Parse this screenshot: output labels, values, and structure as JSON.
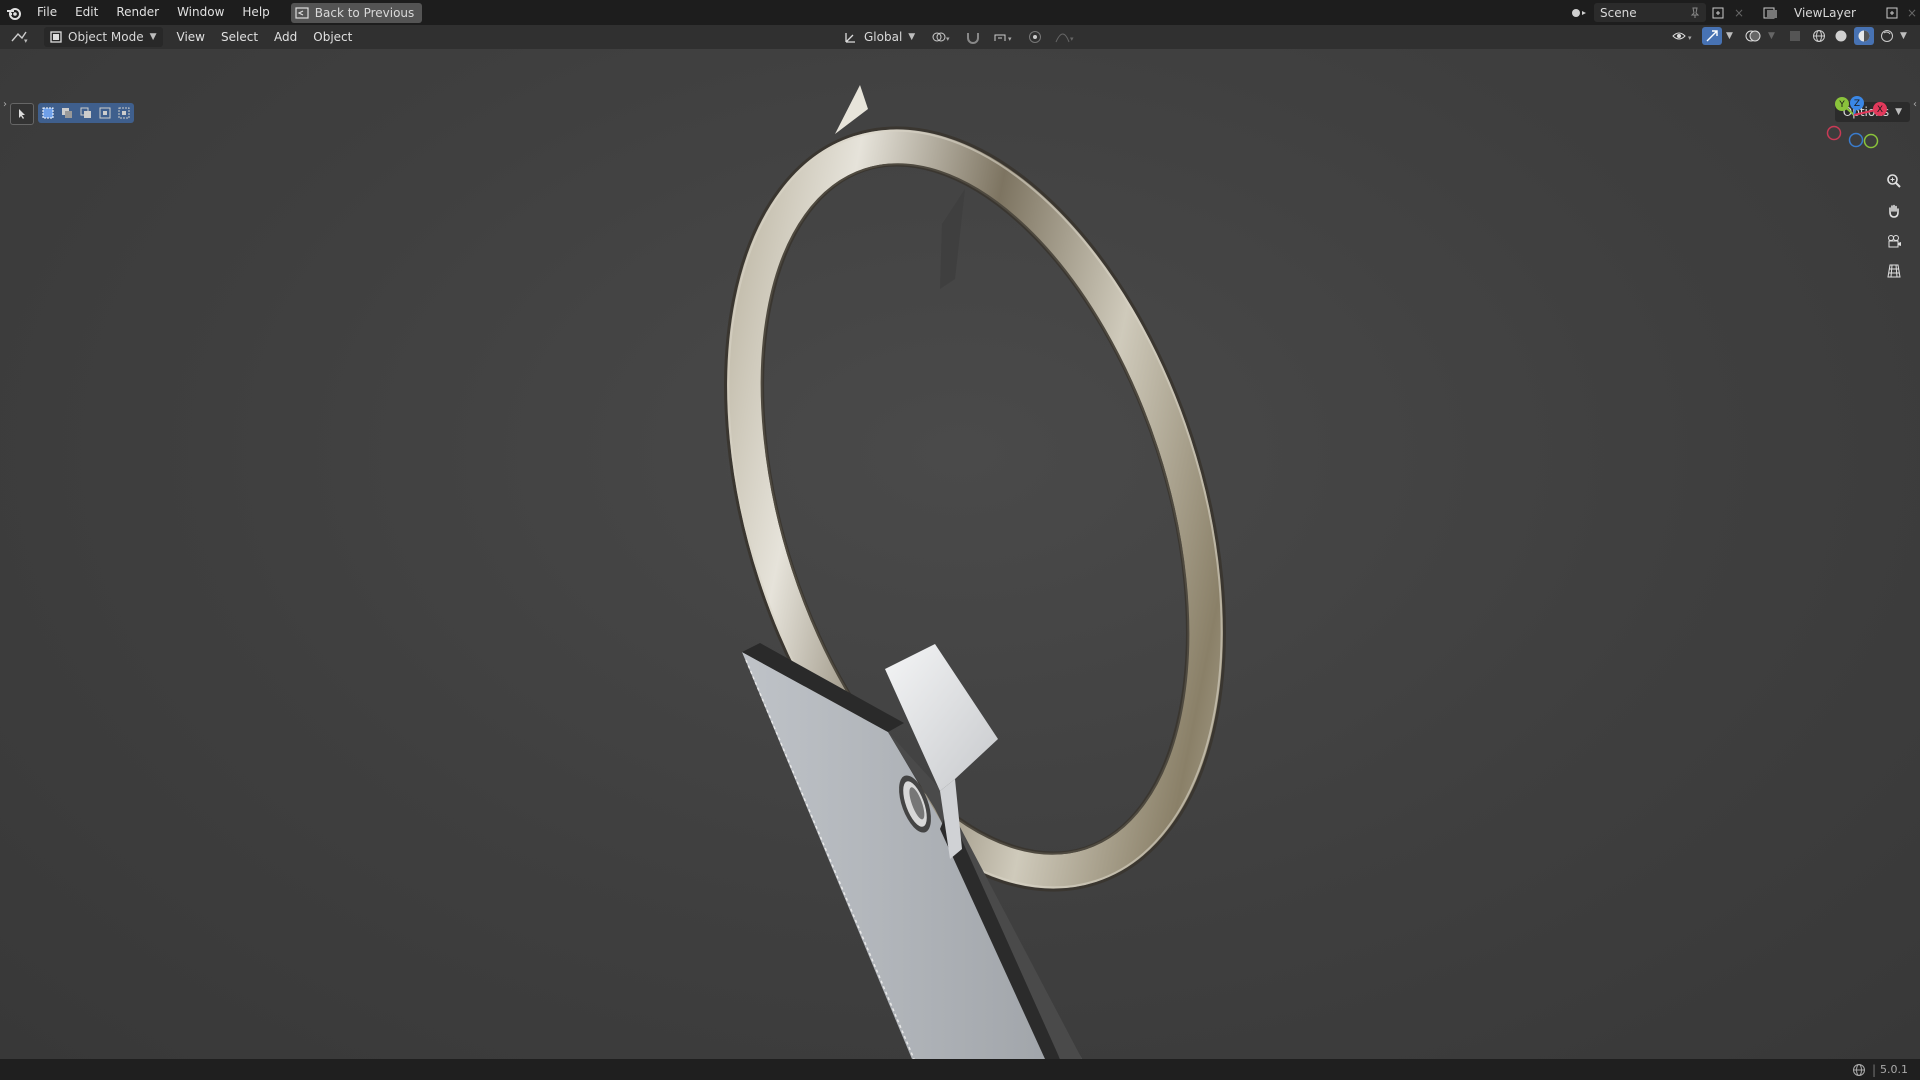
{
  "app": {
    "menu": [
      "File",
      "Edit",
      "Render",
      "Window",
      "Help"
    ],
    "back_button": "Back to Previous",
    "scene": "Scene",
    "view_layer": "ViewLayer"
  },
  "header": {
    "mode": "Object Mode",
    "menus": [
      "View",
      "Select",
      "Add",
      "Object"
    ],
    "orientation": "Global"
  },
  "viewport": {
    "options_label": "Options",
    "gizmo_axes": {
      "y": "Y",
      "z": "Z",
      "x": "X"
    }
  },
  "status": {
    "version": "5.0.1"
  },
  "colors": {
    "accent": "#4772b3",
    "axis_x": "#e2395b",
    "axis_y": "#8ac33b",
    "axis_z": "#3a87e6"
  },
  "icons": {
    "blender_logo": "blender-icon",
    "back": "back-to-previous-icon",
    "zoom": "zoom-icon",
    "pan": "pan-hand-icon",
    "camera": "camera-icon",
    "ortho": "orthographic-grid-icon"
  }
}
